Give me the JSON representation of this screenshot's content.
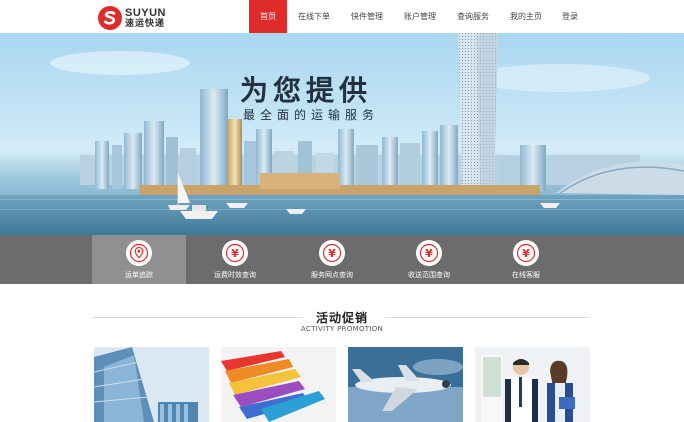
{
  "brand": {
    "en": "SUYUN",
    "cn": "速运快递"
  },
  "nav": [
    {
      "label": "首页",
      "active": true
    },
    {
      "label": "在线下单"
    },
    {
      "label": "快件管理"
    },
    {
      "label": "账户管理"
    },
    {
      "label": "查询服务"
    },
    {
      "label": "我的主页"
    },
    {
      "label": "登录"
    }
  ],
  "banner": {
    "title": "为您提供",
    "subtitle": "最全面的运输服务"
  },
  "services": [
    {
      "label": "运单追踪",
      "icon": "location-pin-icon",
      "active": true
    },
    {
      "label": "运费时效查询",
      "icon": "yen-icon"
    },
    {
      "label": "服务网点查询",
      "icon": "yen-icon"
    },
    {
      "label": "收送范围查询",
      "icon": "yen-icon"
    },
    {
      "label": "在线客服",
      "icon": "yen-icon"
    }
  ],
  "promotion": {
    "title": "活动促销",
    "subtitle": "ACTIVITY PROMOTION",
    "cards": [
      "glass-buildings-image",
      "colorful-ribbons-image",
      "airplane-image",
      "business-people-image"
    ]
  },
  "colors": {
    "accent": "#e02b2b",
    "service_bar": "#6c6c6c",
    "service_active": "#909090"
  }
}
